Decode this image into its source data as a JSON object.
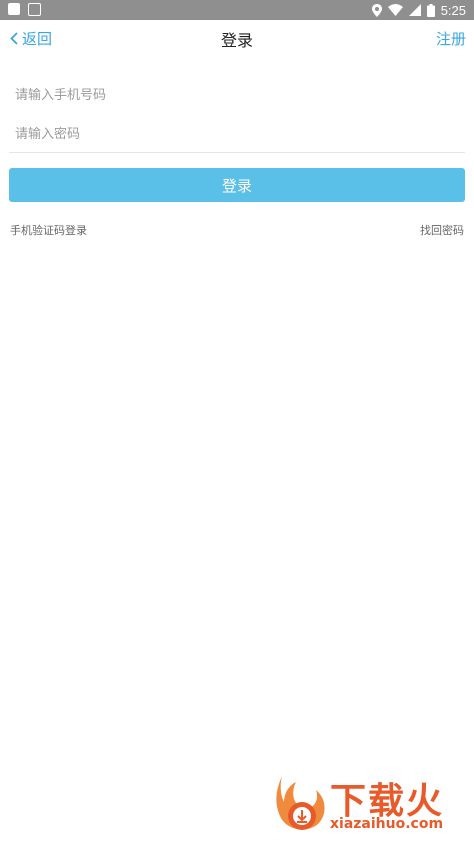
{
  "status_bar": {
    "time": "5:25"
  },
  "navbar": {
    "back_label": "返回",
    "title": "登录",
    "register_label": "注册"
  },
  "form": {
    "phone_placeholder": "请输入手机号码",
    "password_placeholder": "请输入密码",
    "login_label": "登录"
  },
  "links": {
    "sms_login": "手机验证码登录",
    "forgot_password": "找回密码"
  },
  "watermark": {
    "brand": "下载火",
    "url": "xiazaihuo.com"
  },
  "colors": {
    "accent": "#3aa7e3",
    "button": "#5bc0e8",
    "status_bar": "#8f8f8f",
    "watermark": "#e85a2a"
  }
}
